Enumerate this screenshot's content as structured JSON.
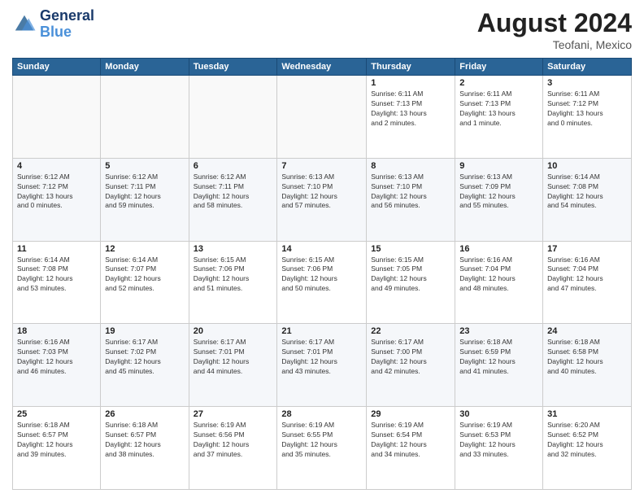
{
  "header": {
    "logo_line1": "General",
    "logo_line2": "Blue",
    "main_title": "August 2024",
    "subtitle": "Teofani, Mexico"
  },
  "weekdays": [
    "Sunday",
    "Monday",
    "Tuesday",
    "Wednesday",
    "Thursday",
    "Friday",
    "Saturday"
  ],
  "weeks": [
    [
      {
        "day": "",
        "info": ""
      },
      {
        "day": "",
        "info": ""
      },
      {
        "day": "",
        "info": ""
      },
      {
        "day": "",
        "info": ""
      },
      {
        "day": "1",
        "info": "Sunrise: 6:11 AM\nSunset: 7:13 PM\nDaylight: 13 hours\nand 2 minutes."
      },
      {
        "day": "2",
        "info": "Sunrise: 6:11 AM\nSunset: 7:13 PM\nDaylight: 13 hours\nand 1 minute."
      },
      {
        "day": "3",
        "info": "Sunrise: 6:11 AM\nSunset: 7:12 PM\nDaylight: 13 hours\nand 0 minutes."
      }
    ],
    [
      {
        "day": "4",
        "info": "Sunrise: 6:12 AM\nSunset: 7:12 PM\nDaylight: 13 hours\nand 0 minutes."
      },
      {
        "day": "5",
        "info": "Sunrise: 6:12 AM\nSunset: 7:11 PM\nDaylight: 12 hours\nand 59 minutes."
      },
      {
        "day": "6",
        "info": "Sunrise: 6:12 AM\nSunset: 7:11 PM\nDaylight: 12 hours\nand 58 minutes."
      },
      {
        "day": "7",
        "info": "Sunrise: 6:13 AM\nSunset: 7:10 PM\nDaylight: 12 hours\nand 57 minutes."
      },
      {
        "day": "8",
        "info": "Sunrise: 6:13 AM\nSunset: 7:10 PM\nDaylight: 12 hours\nand 56 minutes."
      },
      {
        "day": "9",
        "info": "Sunrise: 6:13 AM\nSunset: 7:09 PM\nDaylight: 12 hours\nand 55 minutes."
      },
      {
        "day": "10",
        "info": "Sunrise: 6:14 AM\nSunset: 7:08 PM\nDaylight: 12 hours\nand 54 minutes."
      }
    ],
    [
      {
        "day": "11",
        "info": "Sunrise: 6:14 AM\nSunset: 7:08 PM\nDaylight: 12 hours\nand 53 minutes."
      },
      {
        "day": "12",
        "info": "Sunrise: 6:14 AM\nSunset: 7:07 PM\nDaylight: 12 hours\nand 52 minutes."
      },
      {
        "day": "13",
        "info": "Sunrise: 6:15 AM\nSunset: 7:06 PM\nDaylight: 12 hours\nand 51 minutes."
      },
      {
        "day": "14",
        "info": "Sunrise: 6:15 AM\nSunset: 7:06 PM\nDaylight: 12 hours\nand 50 minutes."
      },
      {
        "day": "15",
        "info": "Sunrise: 6:15 AM\nSunset: 7:05 PM\nDaylight: 12 hours\nand 49 minutes."
      },
      {
        "day": "16",
        "info": "Sunrise: 6:16 AM\nSunset: 7:04 PM\nDaylight: 12 hours\nand 48 minutes."
      },
      {
        "day": "17",
        "info": "Sunrise: 6:16 AM\nSunset: 7:04 PM\nDaylight: 12 hours\nand 47 minutes."
      }
    ],
    [
      {
        "day": "18",
        "info": "Sunrise: 6:16 AM\nSunset: 7:03 PM\nDaylight: 12 hours\nand 46 minutes."
      },
      {
        "day": "19",
        "info": "Sunrise: 6:17 AM\nSunset: 7:02 PM\nDaylight: 12 hours\nand 45 minutes."
      },
      {
        "day": "20",
        "info": "Sunrise: 6:17 AM\nSunset: 7:01 PM\nDaylight: 12 hours\nand 44 minutes."
      },
      {
        "day": "21",
        "info": "Sunrise: 6:17 AM\nSunset: 7:01 PM\nDaylight: 12 hours\nand 43 minutes."
      },
      {
        "day": "22",
        "info": "Sunrise: 6:17 AM\nSunset: 7:00 PM\nDaylight: 12 hours\nand 42 minutes."
      },
      {
        "day": "23",
        "info": "Sunrise: 6:18 AM\nSunset: 6:59 PM\nDaylight: 12 hours\nand 41 minutes."
      },
      {
        "day": "24",
        "info": "Sunrise: 6:18 AM\nSunset: 6:58 PM\nDaylight: 12 hours\nand 40 minutes."
      }
    ],
    [
      {
        "day": "25",
        "info": "Sunrise: 6:18 AM\nSunset: 6:57 PM\nDaylight: 12 hours\nand 39 minutes."
      },
      {
        "day": "26",
        "info": "Sunrise: 6:18 AM\nSunset: 6:57 PM\nDaylight: 12 hours\nand 38 minutes."
      },
      {
        "day": "27",
        "info": "Sunrise: 6:19 AM\nSunset: 6:56 PM\nDaylight: 12 hours\nand 37 minutes."
      },
      {
        "day": "28",
        "info": "Sunrise: 6:19 AM\nSunset: 6:55 PM\nDaylight: 12 hours\nand 35 minutes."
      },
      {
        "day": "29",
        "info": "Sunrise: 6:19 AM\nSunset: 6:54 PM\nDaylight: 12 hours\nand 34 minutes."
      },
      {
        "day": "30",
        "info": "Sunrise: 6:19 AM\nSunset: 6:53 PM\nDaylight: 12 hours\nand 33 minutes."
      },
      {
        "day": "31",
        "info": "Sunrise: 6:20 AM\nSunset: 6:52 PM\nDaylight: 12 hours\nand 32 minutes."
      }
    ]
  ]
}
